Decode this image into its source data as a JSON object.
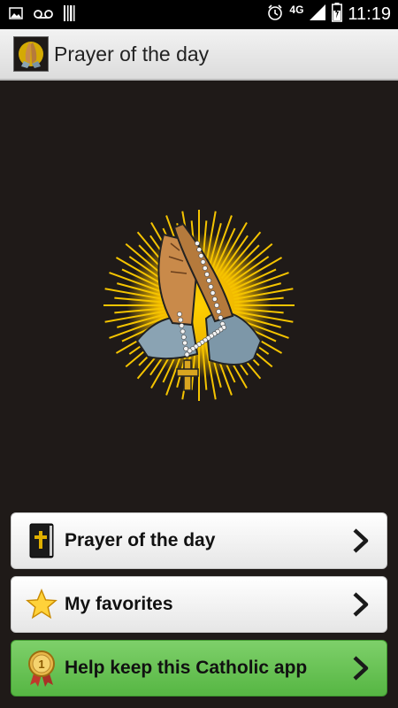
{
  "status_bar": {
    "network": "4G",
    "time": "11:19",
    "icons": [
      "image-icon",
      "voicemail-icon",
      "barcode-icon",
      "alarm-icon",
      "signal-icon",
      "battery-icon"
    ]
  },
  "action_bar": {
    "title": "Prayer of the day",
    "icon": "praying-hands-icon"
  },
  "hero": {
    "image": "praying-hands-with-rosary-illustration",
    "colors": {
      "rays": "#f5c400",
      "hands": "#c98a4a",
      "sleeve": "#8aa3b3",
      "cross": "#d9a520"
    }
  },
  "menu": [
    {
      "label": "Prayer of the day",
      "icon": "bible-icon"
    },
    {
      "label": "My favorites",
      "icon": "star-icon"
    },
    {
      "label": "Help keep this Catholic app",
      "icon": "medal-icon",
      "accent": "#5cbb48"
    }
  ],
  "colors": {
    "background": "#1f1a18",
    "actionbar": "#e6e6e6",
    "green_button": "#5cbb48"
  }
}
